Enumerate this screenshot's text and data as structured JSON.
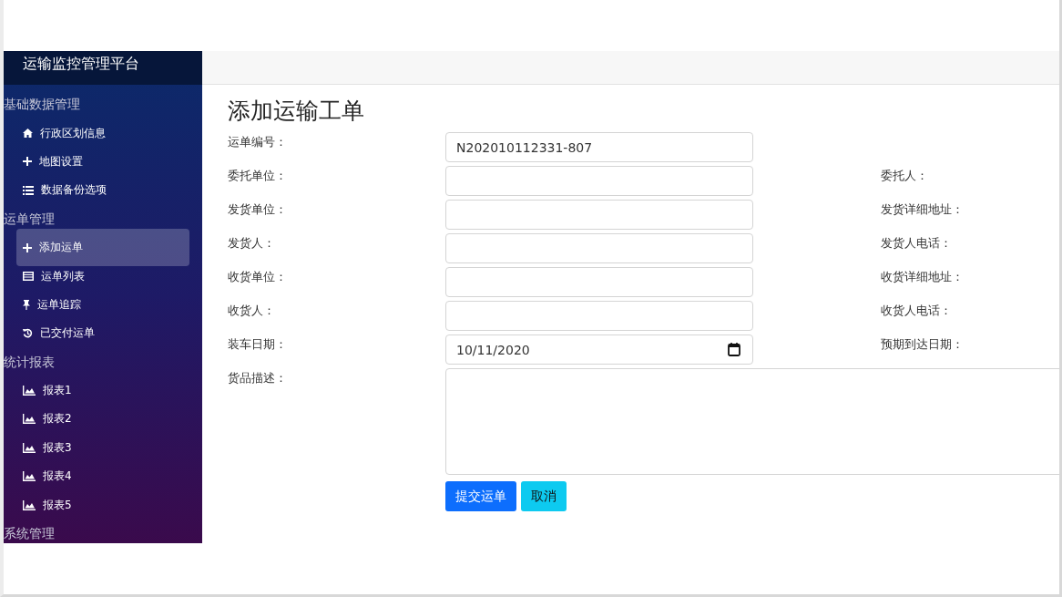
{
  "sidebar": {
    "title": "运输监控管理平台",
    "groups": [
      {
        "label": "基础数据管理",
        "items": [
          {
            "label": "行政区划信息",
            "kind": "home",
            "selected": false
          },
          {
            "label": "地图设置",
            "kind": "plus",
            "selected": false
          },
          {
            "label": "数据备份选项",
            "kind": "list",
            "selected": false
          }
        ]
      },
      {
        "label": "运单管理",
        "items": [
          {
            "label": "添加运单",
            "kind": "plus",
            "selected": true
          },
          {
            "label": "运单列表",
            "kind": "card",
            "selected": false
          },
          {
            "label": "运单追踪",
            "kind": "pin",
            "selected": false
          },
          {
            "label": "已交付运单",
            "kind": "history",
            "selected": false
          }
        ]
      },
      {
        "label": "统计报表",
        "items": [
          {
            "label": "报表1",
            "kind": "chart",
            "selected": false
          },
          {
            "label": "报表2",
            "kind": "chart",
            "selected": false
          },
          {
            "label": "报表3",
            "kind": "chart",
            "selected": false
          },
          {
            "label": "报表4",
            "kind": "chart",
            "selected": false
          },
          {
            "label": "报表5",
            "kind": "chart",
            "selected": false
          }
        ]
      },
      {
        "label": "系统管理"
      }
    ]
  },
  "form": {
    "title": "添加运输工单",
    "rows": [
      {
        "label": "运单编号：",
        "kind": "text",
        "value": "N202010112331-807"
      },
      {
        "label": "委托单位：",
        "kind": "text",
        "side_label": "委托人："
      },
      {
        "label": "发货单位：",
        "kind": "text",
        "side_label": "发货详细地址："
      },
      {
        "label": "发货人：",
        "kind": "text",
        "side_label": "发货人电话："
      },
      {
        "label": "收货单位：",
        "kind": "text",
        "side_label": "收货详细地址："
      },
      {
        "label": "收货人：",
        "kind": "text",
        "side_label": "收货人电话："
      },
      {
        "label": "装车日期：",
        "kind": "date",
        "value": "10/11/2020",
        "side_label": "预期到达日期："
      }
    ],
    "description": {
      "label": "货品描述："
    },
    "buttons": [
      {
        "label": "提交运单",
        "kind": "primary"
      },
      {
        "label": "取消",
        "kind": "info"
      }
    ]
  }
}
